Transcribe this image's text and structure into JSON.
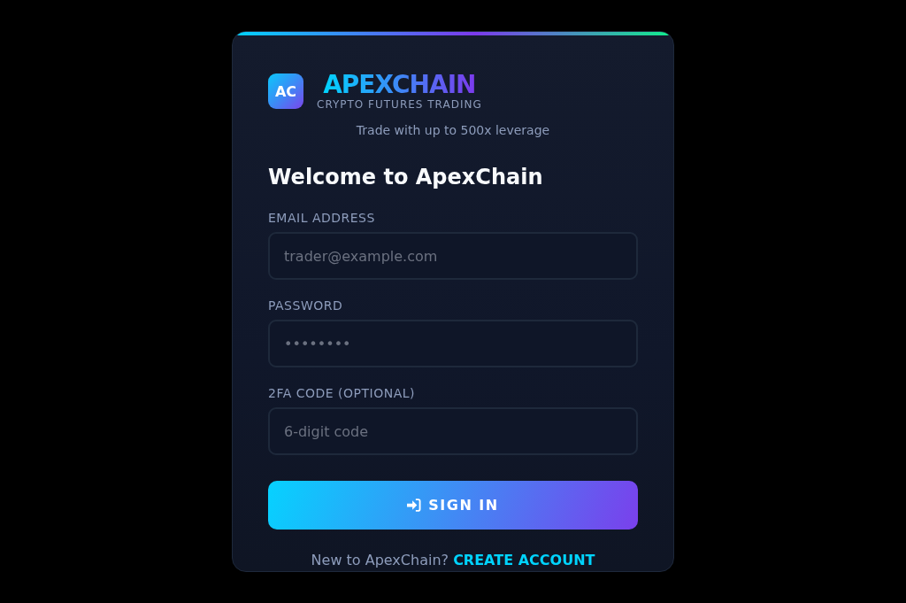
{
  "brand": {
    "logo_mark": "AC",
    "name": "APEXCHAIN",
    "subtitle": "CRYPTO FUTURES TRADING"
  },
  "tagline": "Trade with up to 500x leverage",
  "heading": "Welcome to ApexChain",
  "fields": [
    {
      "label": "EMAIL ADDRESS",
      "placeholder": "trader@example.com"
    },
    {
      "label": "PASSWORD",
      "placeholder": "••••••••"
    },
    {
      "label": "2FA CODE (OPTIONAL)",
      "placeholder": "6-digit code"
    }
  ],
  "submit_button": {
    "label": "SIGN IN"
  },
  "footer": {
    "prompt": "New to ApexChain?",
    "link": "CREATE ACCOUNT"
  }
}
